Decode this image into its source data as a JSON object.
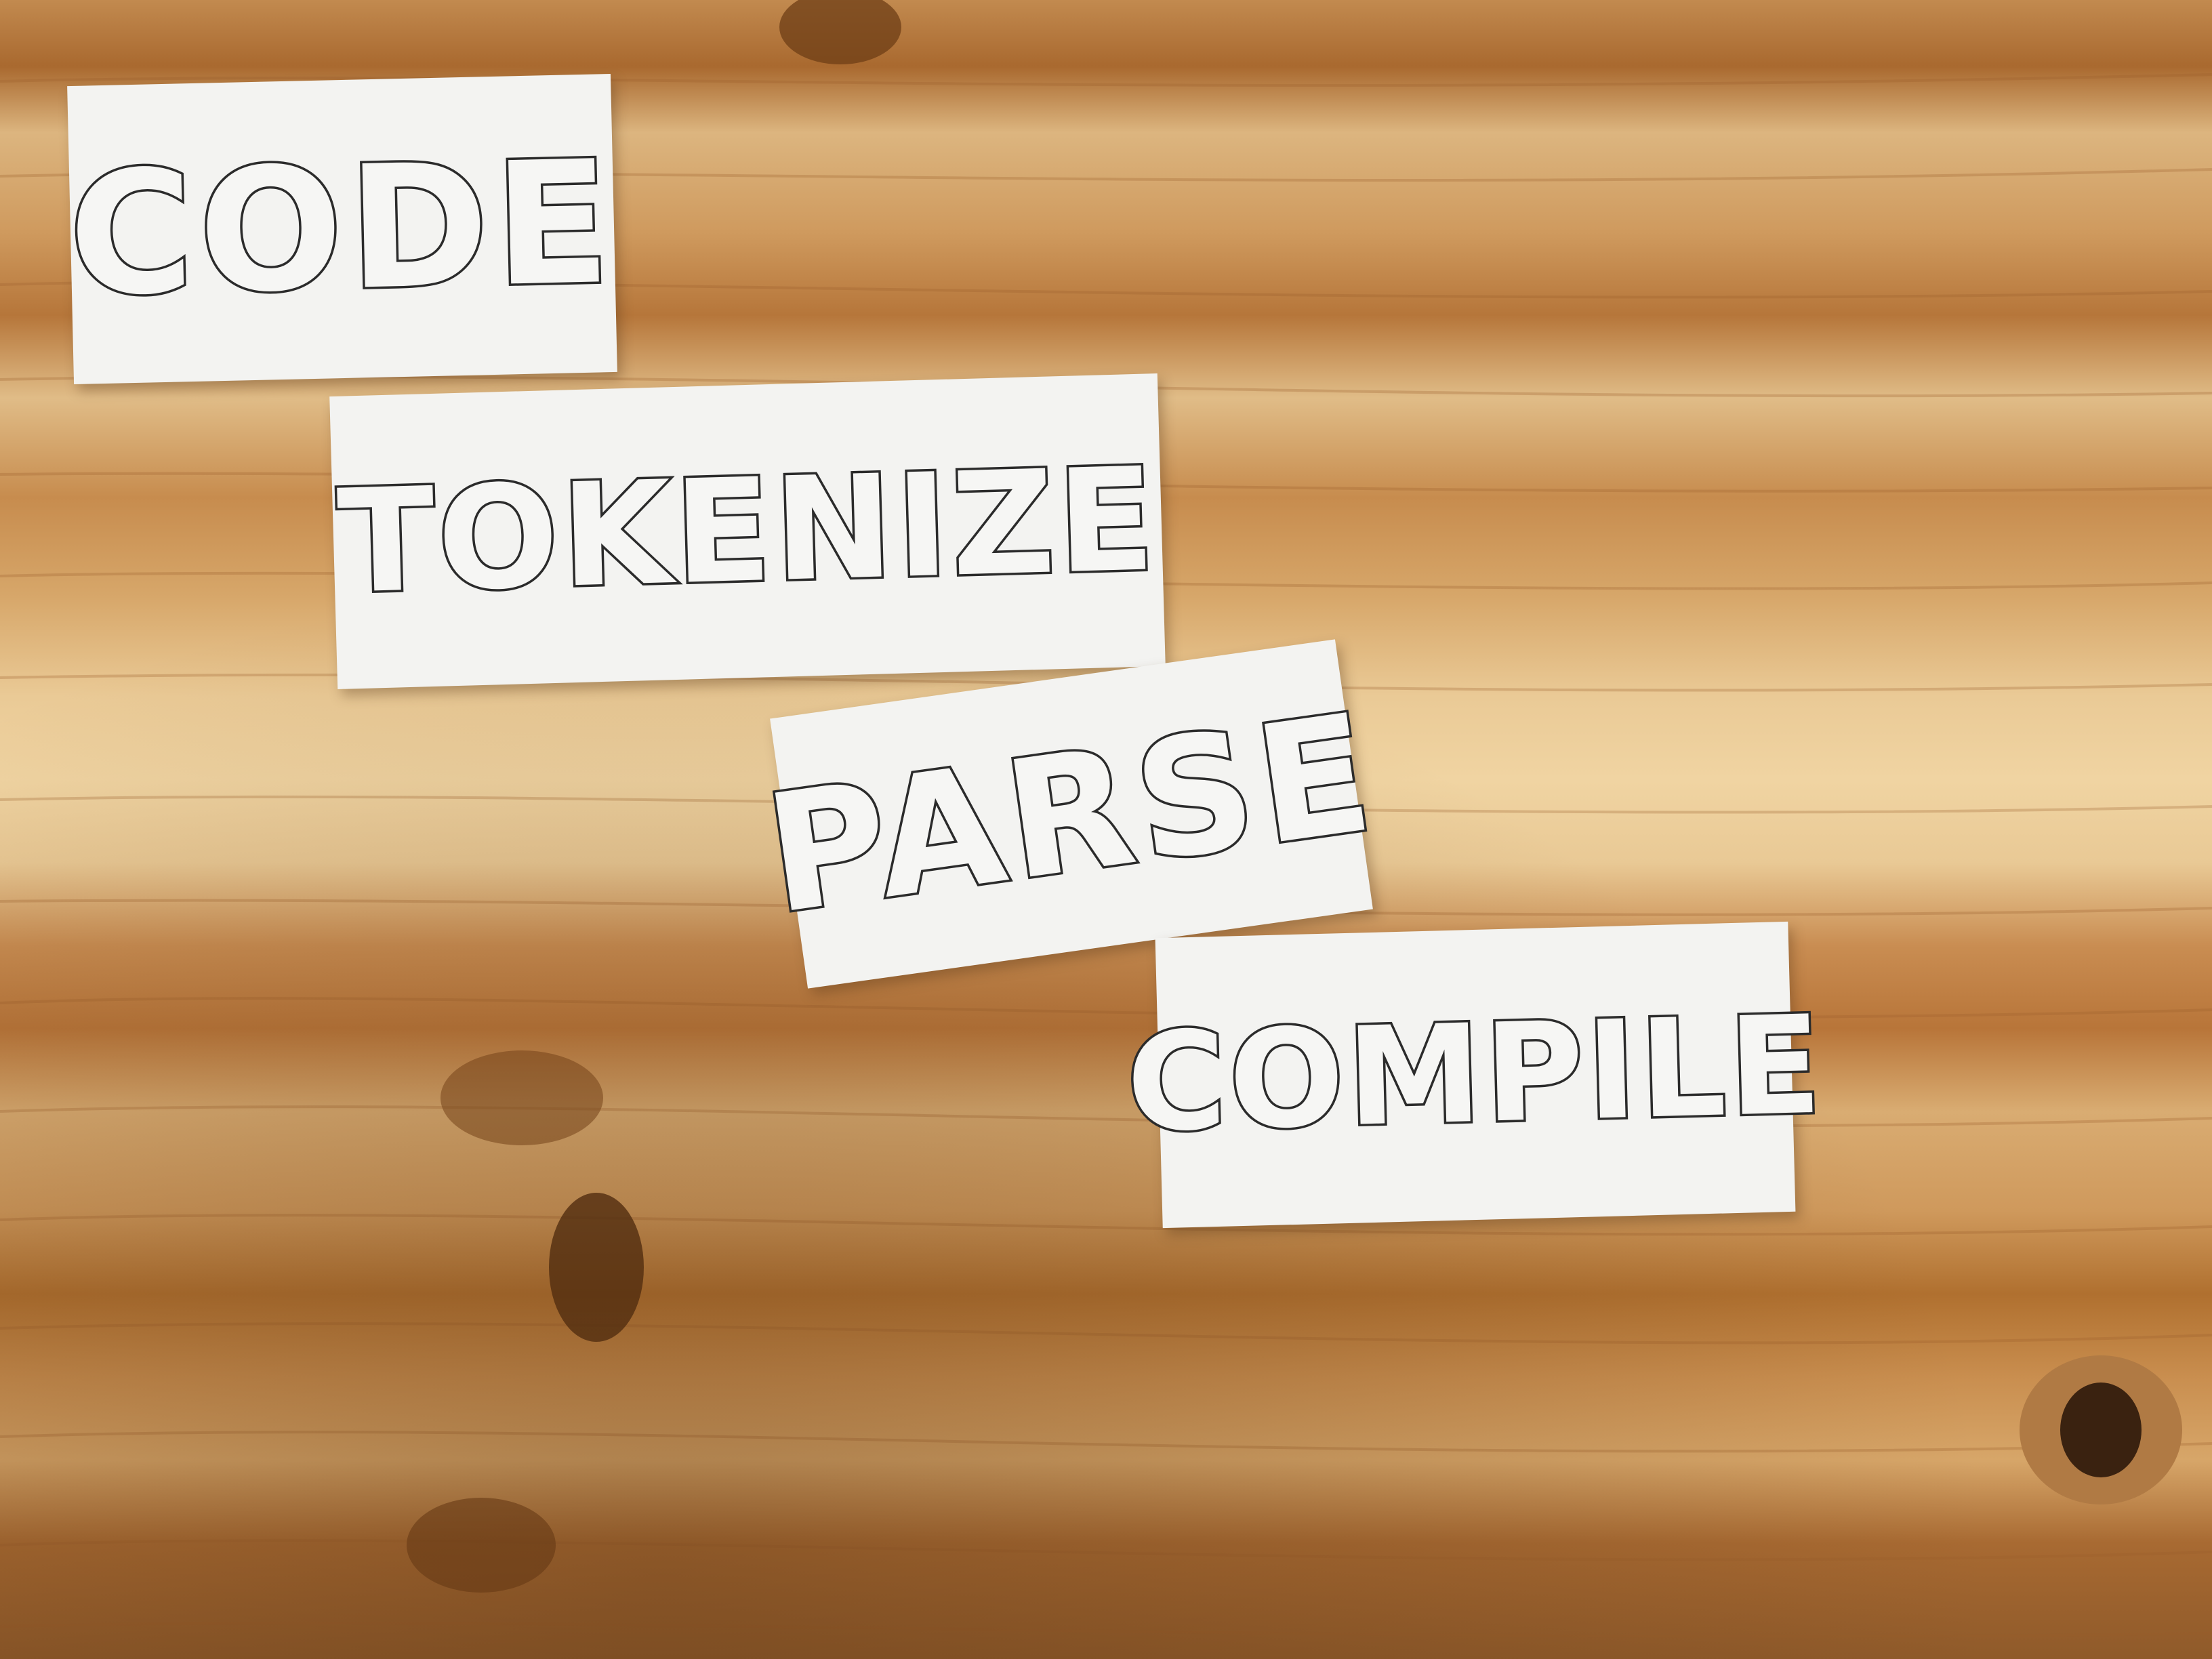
{
  "scene": {
    "surface": "pine-wood-table",
    "cards": [
      {
        "label": "CODE"
      },
      {
        "label": "TOKENIZE"
      },
      {
        "label": "PARSE"
      },
      {
        "label": "COMPILE"
      }
    ]
  },
  "colors": {
    "wood_light": "#e2c08c",
    "wood_dark": "#a8652c",
    "card": "#f3f3f1",
    "ink": "#2b2b2b"
  }
}
